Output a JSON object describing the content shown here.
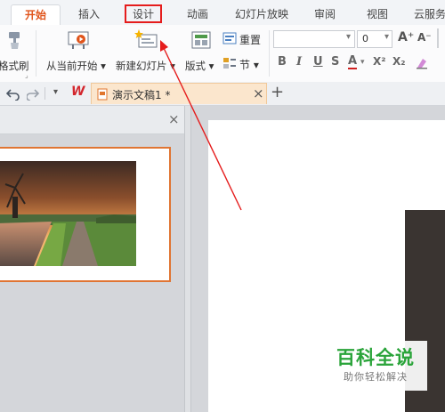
{
  "tabs": [
    {
      "label": "开始",
      "active": true
    },
    {
      "label": "插入"
    },
    {
      "label": "设计",
      "highlighted": true
    },
    {
      "label": "动画"
    },
    {
      "label": "幻灯片放映"
    },
    {
      "label": "审阅"
    },
    {
      "label": "视图"
    },
    {
      "label": "云服务"
    }
  ],
  "ribbon": {
    "format_painter": "格式刷",
    "from_current": "从当前开始",
    "new_slide": "新建幻灯片",
    "layout": "版式",
    "reset": "重置",
    "section": "节",
    "font_size": "0",
    "bold": "B",
    "italic": "I",
    "underline": "U",
    "strike": "S",
    "font_color": "A",
    "superscript": "X²",
    "subscript": "X₂",
    "grow_font": "A⁺",
    "shrink_font": "A⁻"
  },
  "docbar": {
    "logo": "W",
    "doc_title": "演示文稿1 *",
    "close": "×",
    "add": "+"
  },
  "panel": {
    "close": "×"
  },
  "watermark": {
    "title": "百科全说",
    "subtitle": "助你轻松解决"
  },
  "colors": {
    "accent": "#e0541b",
    "highlight_box": "#e51c1c",
    "thumb_border": "#e07533",
    "watermark_green": "#2aa43a"
  },
  "icons": [
    "brush-icon",
    "play-from-current-icon",
    "new-slide-icon",
    "layout-icon",
    "reset-icon",
    "section-icon",
    "undo-icon",
    "redo-icon",
    "dropdown-icon",
    "wps-logo",
    "document-icon",
    "close-icon",
    "plus-icon"
  ]
}
